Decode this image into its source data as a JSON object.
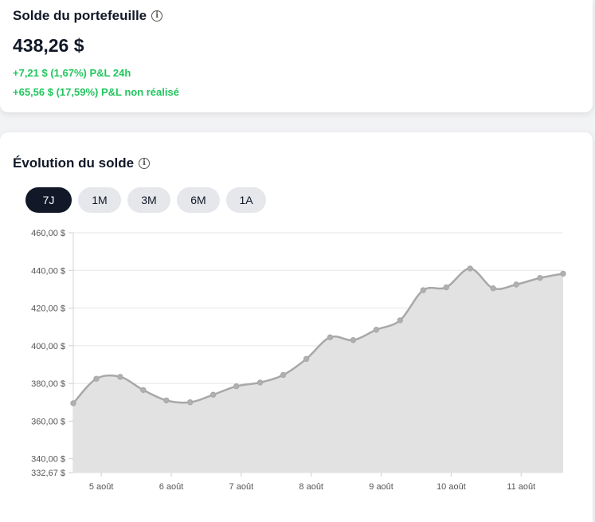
{
  "balance": {
    "title": "Solde du portefeuille",
    "value": "438,26 $",
    "pnl_24h": "+7,21 $ (1,67%) P&L 24h",
    "pnl_unrealized": "+65,56 $ (17,59%) P&L non réalisé",
    "positive_color": "#22c55e"
  },
  "evolution": {
    "title": "Évolution du solde",
    "tabs": [
      {
        "label": "7J",
        "active": true
      },
      {
        "label": "1M",
        "active": false
      },
      {
        "label": "3M",
        "active": false
      },
      {
        "label": "6M",
        "active": false
      },
      {
        "label": "1A",
        "active": false
      }
    ]
  },
  "chart_data": {
    "type": "area",
    "title": "",
    "xlabel": "",
    "ylabel": "",
    "ylim": [
      332.67,
      460
    ],
    "y_ticks": [
      {
        "value": 460,
        "label": "460,00 $"
      },
      {
        "value": 440,
        "label": "440,00 $"
      },
      {
        "value": 420,
        "label": "420,00 $"
      },
      {
        "value": 400,
        "label": "400,00 $"
      },
      {
        "value": 380,
        "label": "380,00 $"
      },
      {
        "value": 360,
        "label": "360,00 $"
      },
      {
        "value": 340,
        "label": "340,00 $"
      },
      {
        "value": 332.67,
        "label": "332,67 $"
      }
    ],
    "x_ticks": [
      {
        "x": 0.4,
        "label": "5 août"
      },
      {
        "x": 1.4,
        "label": "6 août"
      },
      {
        "x": 2.4,
        "label": "7 août"
      },
      {
        "x": 3.4,
        "label": "8 août"
      },
      {
        "x": 4.4,
        "label": "9 août"
      },
      {
        "x": 5.4,
        "label": "10 août"
      },
      {
        "x": 6.4,
        "label": "11 août"
      }
    ],
    "x_range": [
      -0.0,
      7.0
    ],
    "series": [
      {
        "x": [
          0.0,
          0.33,
          0.67,
          1.0,
          1.33,
          1.67,
          2.0,
          2.33,
          2.67,
          3.0,
          3.33,
          3.67,
          4.0,
          4.33,
          4.67,
          5.0,
          5.33,
          5.67,
          6.0,
          6.33,
          6.67,
          7.0
        ],
        "values": [
          369.5,
          382.5,
          383.5,
          376.5,
          371.0,
          370.0,
          374.0,
          378.5,
          380.5,
          384.5,
          393.0,
          404.5,
          403.0,
          408.5,
          413.5,
          429.5,
          431.0,
          441.0,
          430.5,
          432.5,
          436.0,
          438.26
        ]
      }
    ],
    "grid": true,
    "colors": {
      "line": "#a8a8a8",
      "fill": "#e2e2e2",
      "point": "#b0b0b0",
      "grid": "#e5e5e5"
    }
  }
}
